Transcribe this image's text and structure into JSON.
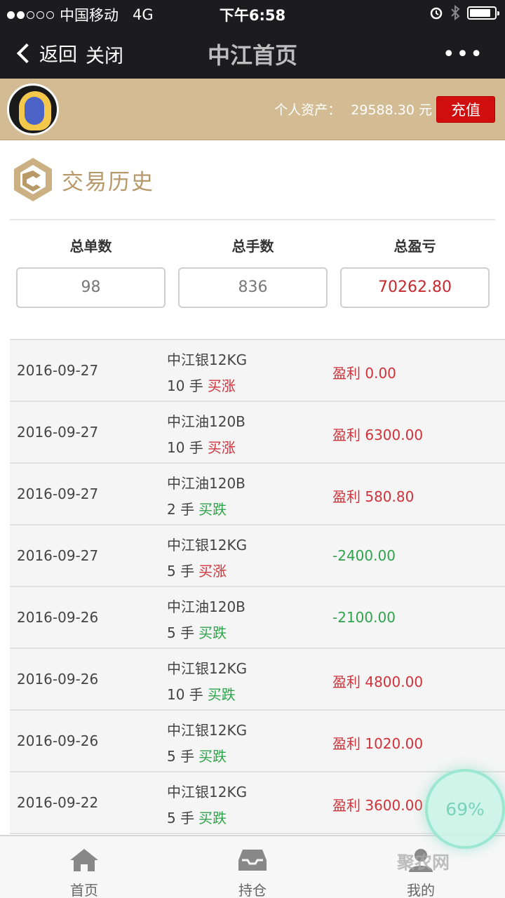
{
  "status": {
    "carrier": "中国移动",
    "network": "4G",
    "time": "下午6:58",
    "battery_level": 0.85
  },
  "nav": {
    "back_label": "返回",
    "close_label": "关闭",
    "title": "中江首页",
    "more": "•••"
  },
  "account": {
    "assets_label": "个人资产：",
    "assets_value": "29588.30 元",
    "recharge_label": "充值"
  },
  "section": {
    "title": "交易历史"
  },
  "summary": [
    {
      "label": "总单数",
      "value": "98"
    },
    {
      "label": "总手数",
      "value": "836"
    },
    {
      "label": "总盈亏",
      "value": "70262.80"
    }
  ],
  "trades": [
    {
      "date": "2016-09-27",
      "product": "中江银12KG",
      "lots": "10 手",
      "direction": "买涨",
      "result": "盈利 0.00"
    },
    {
      "date": "2016-09-27",
      "product": "中江油120B",
      "lots": "10 手",
      "direction": "买涨",
      "result": "盈利 6300.00"
    },
    {
      "date": "2016-09-27",
      "product": "中江油120B",
      "lots": "2 手",
      "direction": "买跌",
      "result": "盈利 580.80"
    },
    {
      "date": "2016-09-27",
      "product": "中江银12KG",
      "lots": "5 手",
      "direction": "买涨",
      "result": "-2400.00"
    },
    {
      "date": "2016-09-26",
      "product": "中江油120B",
      "lots": "5 手",
      "direction": "买跌",
      "result": "-2100.00"
    },
    {
      "date": "2016-09-26",
      "product": "中江银12KG",
      "lots": "10 手",
      "direction": "买跌",
      "result": "盈利 4800.00"
    },
    {
      "date": "2016-09-26",
      "product": "中江银12KG",
      "lots": "5 手",
      "direction": "买跌",
      "result": "盈利 1020.00"
    },
    {
      "date": "2016-09-22",
      "product": "中江银12KG",
      "lots": "5 手",
      "direction": "买跌",
      "result": "盈利 3600.00"
    }
  ],
  "tabs": [
    {
      "label": "首页",
      "icon": "home-icon"
    },
    {
      "label": "持仓",
      "icon": "inbox-icon"
    },
    {
      "label": "我的",
      "icon": "user-icon"
    }
  ],
  "overlay": {
    "percent": "69%",
    "watermark": "聚农网"
  },
  "colors": {
    "profit": "#d0323a",
    "loss": "#2ea44a",
    "brand_gold": "#d3bc93",
    "recharge": "#d10e0e"
  }
}
